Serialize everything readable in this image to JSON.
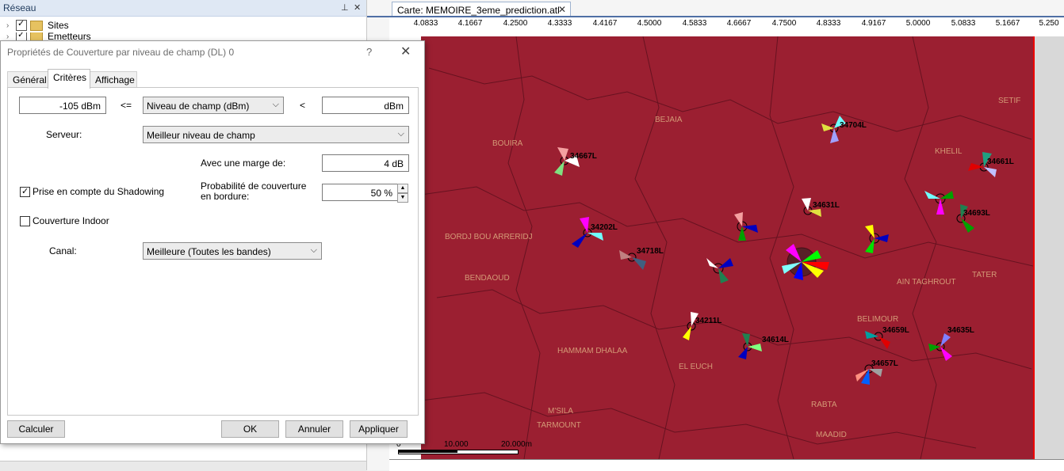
{
  "network_panel": {
    "title": "Réseau",
    "pin_icon": "pin-icon",
    "close_icon": "close-icon",
    "tree": [
      {
        "label": "Sites"
      },
      {
        "label": "Emetteurs"
      }
    ]
  },
  "map": {
    "tab_title": "Carte: MEMOIRE_3eme_prediction.atl",
    "ruler_ticks": [
      "4.0833",
      "4.1667",
      "4.2500",
      "4.3333",
      "4.4167",
      "4.5000",
      "4.5833",
      "4.6667",
      "4.7500",
      "4.8333",
      "4.9167",
      "5.0000",
      "5.0833",
      "5.1667",
      "5.250"
    ],
    "scale": {
      "zero": "0",
      "mid": "10.000",
      "end": "20.000m"
    },
    "place_labels": [
      "BOUIRA",
      "BEJAIA",
      "M'SILA",
      "BORDJ BOU ARRERIDJ",
      "BENDAOUD",
      "HAMMAM DHALAA",
      "EL EUCH",
      "RABTA",
      "BELIMOUR",
      "AIN TAGHROUT",
      "TATER",
      "MAADID",
      "TARMOUNT",
      "KHELIL",
      "SETIF"
    ],
    "site_labels": [
      "34667L",
      "34704L",
      "34661L",
      "34202L",
      "34718L",
      "34631L",
      "34693L",
      "34211L",
      "34614L",
      "34659L",
      "34635L",
      "34657L"
    ]
  },
  "dialog": {
    "title": "Propriétés de Couverture par niveau de champ (DL) 0",
    "help": "?",
    "tabs": [
      "Général",
      "Critères",
      "Affichage"
    ],
    "active_tab": "Critères",
    "min_value": "-105  dBm",
    "op1": "<=",
    "criterion": "Niveau de champ (dBm)",
    "op2": "<",
    "max_value": "dBm",
    "server_label": "Serveur:",
    "server_value": "Meilleur niveau de champ",
    "margin_label": "Avec une marge de:",
    "margin_value": "4  dB",
    "shadowing_label": "Prise en compte du Shadowing",
    "shadowing_checked": true,
    "edge_prob_label_1": "Probabilité de couverture",
    "edge_prob_label_2": "en bordure:",
    "edge_prob_value": "50  %",
    "indoor_label": "Couverture Indoor",
    "indoor_checked": false,
    "channel_label": "Canal:",
    "channel_value": "Meilleure (Toutes les bandes)",
    "buttons": {
      "compute": "Calculer",
      "ok": "OK",
      "cancel": "Annuler",
      "apply": "Appliquer"
    }
  },
  "colors": {
    "map_fill": "#9b1f31",
    "title_bar": "#dfe8f4",
    "accent": "#4f6fa5"
  }
}
